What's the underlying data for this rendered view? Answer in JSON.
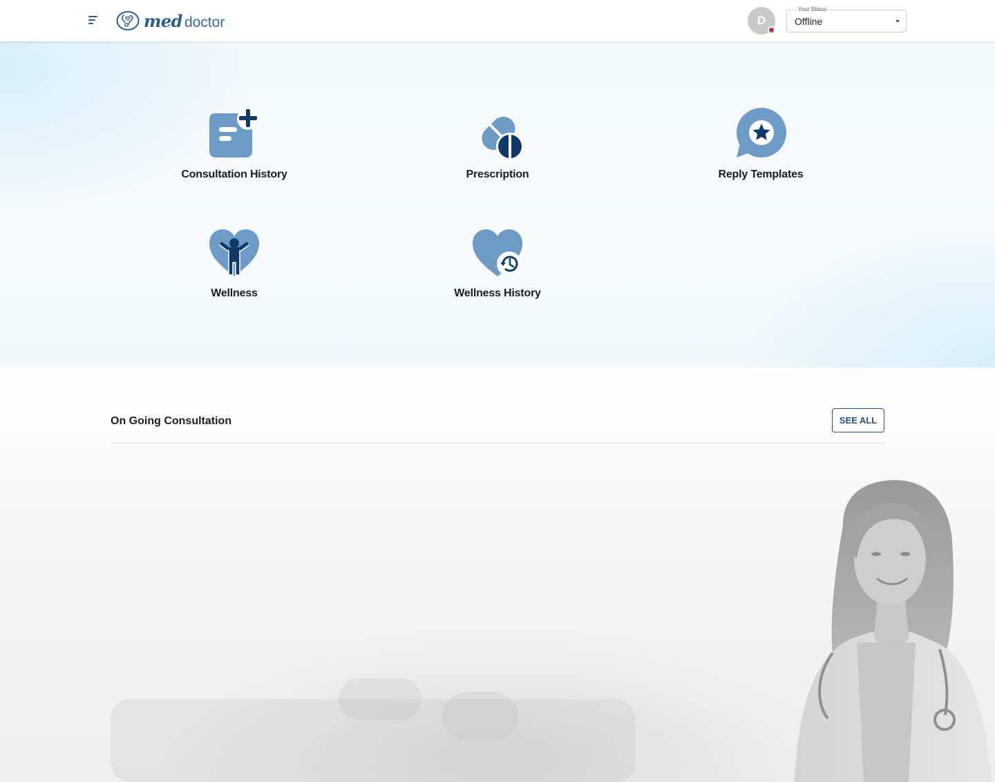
{
  "header": {
    "logo_text_1": "med",
    "logo_text_2": "doctor",
    "avatar_initial": "D",
    "status_legend": "Your Status",
    "status_value": "Offline",
    "status_dot_color": "#b53a3a"
  },
  "tiles": [
    {
      "label": "Consultation History",
      "icon": "consultation-history-icon"
    },
    {
      "label": "Prescription",
      "icon": "prescription-pill-icon"
    },
    {
      "label": "Reply Templates",
      "icon": "reply-templates-star-icon"
    },
    {
      "label": "Wellness",
      "icon": "wellness-heart-person-icon"
    },
    {
      "label": "Wellness History",
      "icon": "wellness-history-heart-clock-icon"
    }
  ],
  "ongoing": {
    "title": "On Going Consultation",
    "see_all_label": "SEE ALL"
  },
  "colors": {
    "icon_light": "#6e9bc6",
    "icon_dark": "#0f3a68",
    "brand": "#2b5d95",
    "button_border": "#2a4f86"
  }
}
